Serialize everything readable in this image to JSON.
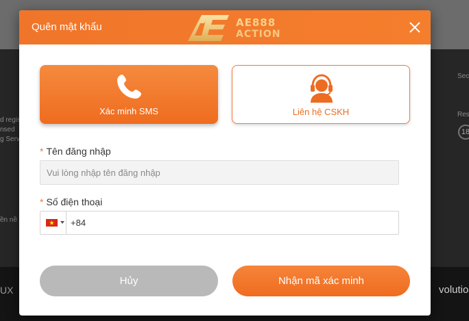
{
  "background": {
    "left_text": [
      "d regis",
      "nsed",
      "g Serv",
      "ền nề"
    ],
    "right_text": [
      "Sec",
      "Res"
    ],
    "badge": "18",
    "bottom_left": "UX",
    "bottom_right": "volution"
  },
  "modal": {
    "title": "Quên mật khẩu",
    "logo": {
      "line1": "AE888",
      "line2": "ACTION",
      "icon": "ae-logo-icon"
    },
    "close_icon": "close-icon",
    "options": [
      {
        "label": "Xác minh SMS",
        "icon": "phone-icon",
        "selected": true
      },
      {
        "label": "Liên hệ CSKH",
        "icon": "headset-agent-icon",
        "selected": false
      }
    ],
    "fields": {
      "username": {
        "label": "Tên đăng nhập",
        "required_mark": "*",
        "placeholder": "Vui lòng nhập tên đăng nhập",
        "value": ""
      },
      "phone": {
        "label": "Số điện thoại",
        "required_mark": "*",
        "country": "Vietnam",
        "flag_icon": "vietnam-flag-icon",
        "value": "+84"
      }
    },
    "buttons": {
      "cancel": "Hủy",
      "submit": "Nhận mã xác minh"
    }
  },
  "colors": {
    "accent": "#f07a2c",
    "cancel": "#b9b9b9",
    "text": "#333333"
  }
}
